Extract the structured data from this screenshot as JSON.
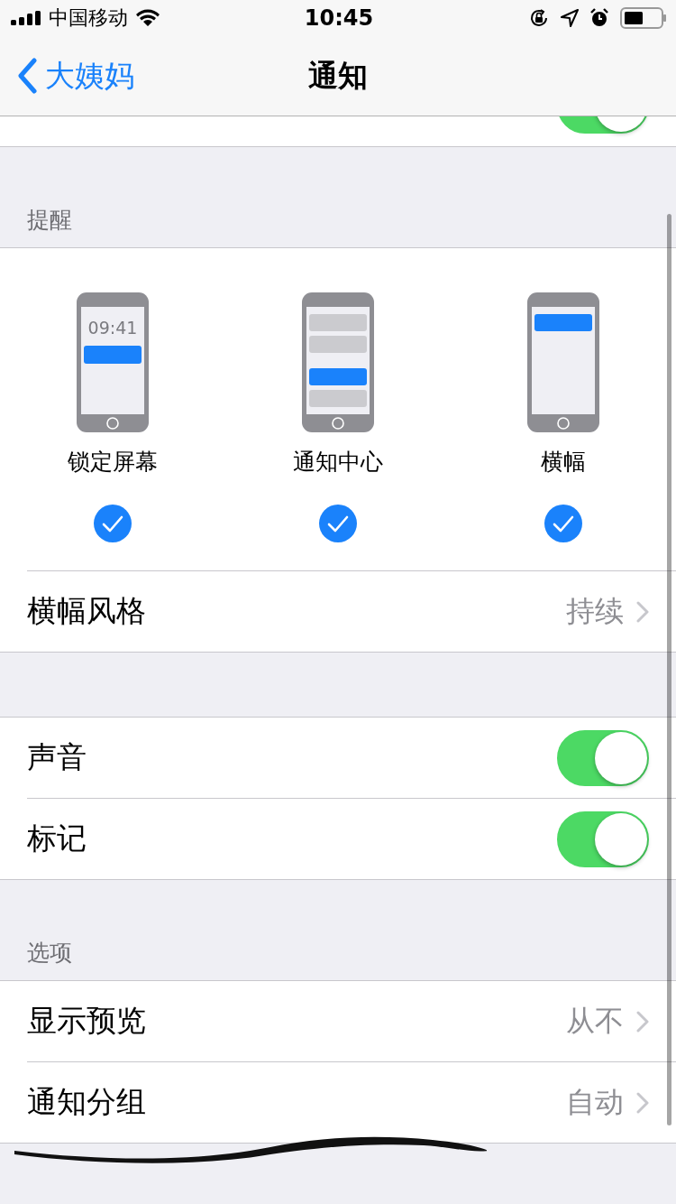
{
  "status_bar": {
    "carrier": "中国移动",
    "time": "10:45"
  },
  "nav": {
    "back": "大姨妈",
    "title": "通知"
  },
  "allow_row": {
    "on": true
  },
  "alerts": {
    "header": "提醒",
    "styles": [
      {
        "kind": "lock",
        "clock": "09:41",
        "label": "锁定屏幕",
        "checked": true
      },
      {
        "kind": "center",
        "label": "通知中心",
        "checked": true
      },
      {
        "kind": "banner",
        "label": "横幅",
        "checked": true
      }
    ],
    "banner_style": {
      "label": "横幅风格",
      "value": "持续"
    }
  },
  "toggles": [
    {
      "label": "声音",
      "on": true
    },
    {
      "label": "标记",
      "on": true
    }
  ],
  "options": {
    "header": "选项",
    "rows": [
      {
        "label": "显示预览",
        "value": "从不"
      },
      {
        "label": "通知分组",
        "value": "自动"
      }
    ]
  }
}
